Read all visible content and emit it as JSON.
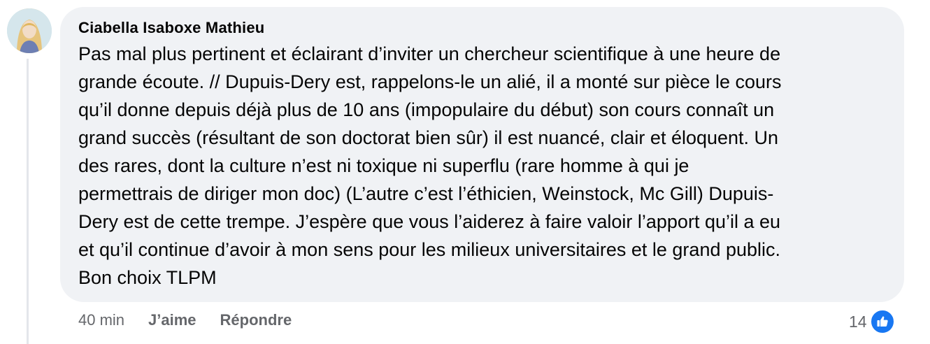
{
  "comment": {
    "author": "Ciabella Isaboxe Mathieu",
    "text": "Pas mal plus pertinent et éclairant d’inviter un chercheur scientifique à une heure de\ngrande écoute. // Dupuis-Dery est, rappelons-le un alié, il a monté sur pièce le cours\nqu’il donne depuis déjà plus de 10 ans (impopulaire du début) son cours connaît un\ngrand succès (résultant de son doctorat bien sûr) il est nuancé, clair et éloquent. Un\ndes rares, dont la culture n’est ni toxique ni superflu (rare homme à qui je\npermettrais de diriger mon doc) (L’autre c’est l’éthicien, Weinstock, Mc Gill) Dupuis-\nDery est de cette trempe. J’espère que vous l’aiderez à faire valoir l’apport qu’il a eu\net qu’il continue d’avoir à mon sens pour les milieux universitaires et le grand public.\nBon choix TLPM",
    "time": "40 min",
    "like_label": "J’aime",
    "reply_label": "Répondre",
    "reaction_count": "14",
    "reaction_icon": "thumbs-up-icon",
    "accent_color": "#1877f2"
  }
}
